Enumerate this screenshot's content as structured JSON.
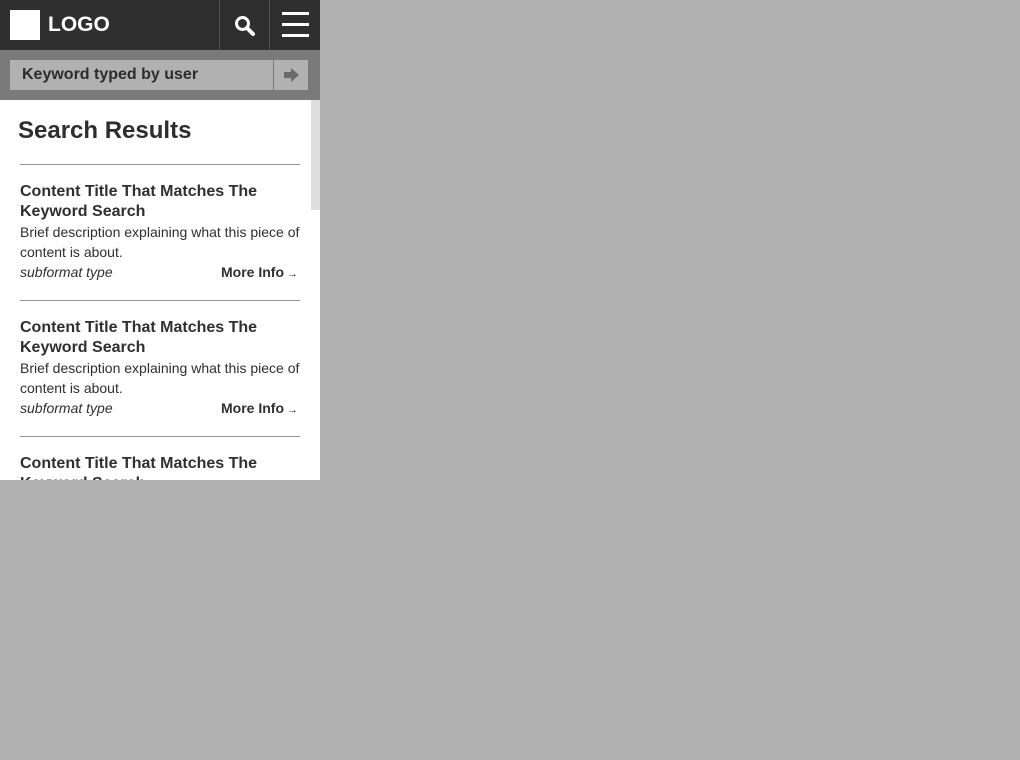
{
  "header": {
    "logo_text": "LOGO",
    "search_icon": "search-icon",
    "menu_icon": "hamburger-menu-icon"
  },
  "search": {
    "keyword": "Keyword typed by user",
    "submit_icon": "arrow-right-icon"
  },
  "results": {
    "title": "Search Results",
    "items": [
      {
        "title": "Content Title That Matches The Keyword Search",
        "description": "Brief description explaining what this piece of content is about.",
        "type": "subformat type",
        "more": "More Info",
        "arrow": "→"
      },
      {
        "title": "Content Title That Matches The Keyword Search",
        "description": "Brief description explaining what this piece of content is about.",
        "type": "subformat type",
        "more": "More Info",
        "arrow": "→"
      },
      {
        "title": "Content Title That Matches The Keyword Search",
        "description": "",
        "type": "",
        "more": "",
        "arrow": ""
      }
    ]
  },
  "colors": {
    "header_bg": "#2f2f2f",
    "search_bar_bg": "#7a7a7a",
    "field_bg": "#b1b1b1",
    "page_bg": "#b0b0b0"
  }
}
